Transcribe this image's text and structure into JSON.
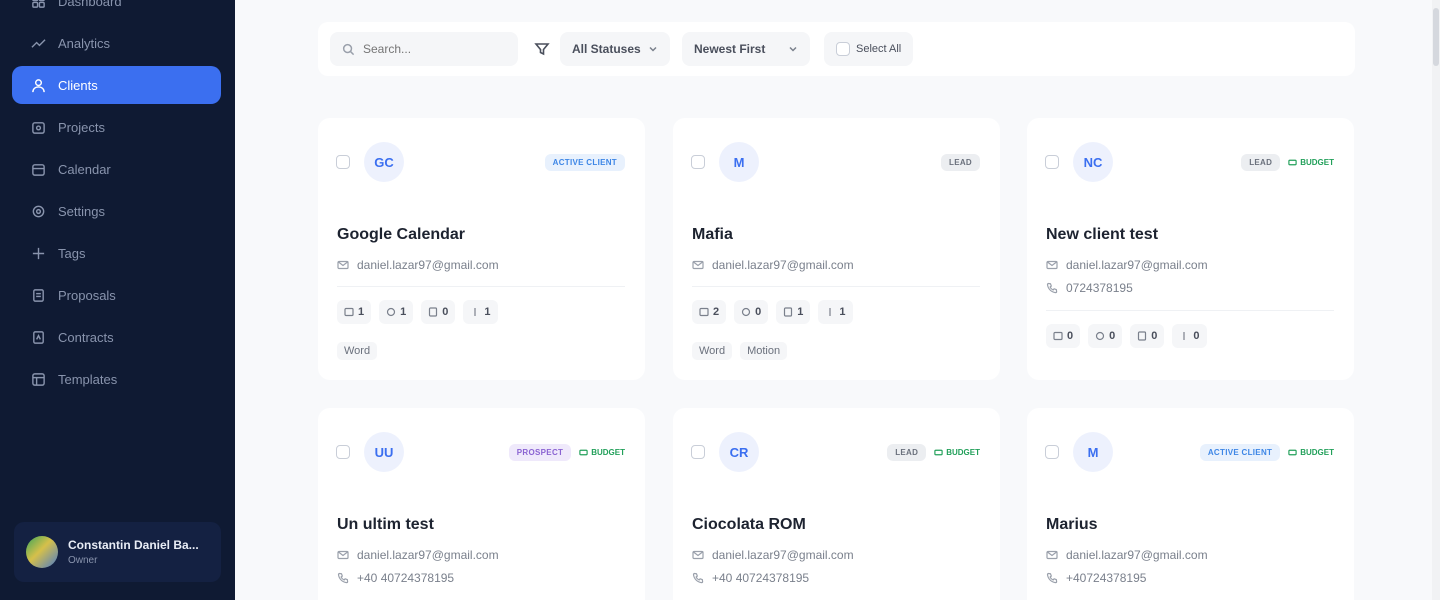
{
  "sidebar": {
    "items": [
      {
        "label": "Dashboard",
        "icon": "grid-icon",
        "active": false
      },
      {
        "label": "Analytics",
        "icon": "trend-icon",
        "active": false
      },
      {
        "label": "Clients",
        "icon": "user-icon",
        "active": true
      },
      {
        "label": "Projects",
        "icon": "folder-icon",
        "active": false
      },
      {
        "label": "Calendar",
        "icon": "calendar-icon",
        "active": false
      },
      {
        "label": "Settings",
        "icon": "gear-icon",
        "active": false
      },
      {
        "label": "Tags",
        "icon": "tag-icon",
        "active": false
      },
      {
        "label": "Proposals",
        "icon": "document-icon",
        "active": false
      },
      {
        "label": "Contracts",
        "icon": "contract-icon",
        "active": false
      },
      {
        "label": "Templates",
        "icon": "template-icon",
        "active": false
      }
    ],
    "user": {
      "name": "Constantin Daniel Ba...",
      "role": "Owner"
    }
  },
  "toolbar": {
    "search_placeholder": "Search...",
    "status_select": "All Statuses",
    "sort_select": "Newest First",
    "select_all_label": "Select All"
  },
  "clients": [
    {
      "initials": "GC",
      "name": "Google Calendar",
      "email": "daniel.lazar97@gmail.com",
      "phone": "",
      "badges": [
        {
          "text": "ACTIVE CLIENT",
          "kind": "active"
        }
      ],
      "budget": "",
      "stats": [
        "1",
        "1",
        "0",
        "1"
      ],
      "tags": [
        "Word"
      ]
    },
    {
      "initials": "M",
      "name": "Mafia",
      "email": "daniel.lazar97@gmail.com",
      "phone": "",
      "badges": [
        {
          "text": "LEAD",
          "kind": "lead"
        }
      ],
      "budget": "",
      "stats": [
        "2",
        "0",
        "1",
        "1"
      ],
      "tags": [
        "Word",
        "Motion"
      ]
    },
    {
      "initials": "NC",
      "name": "New client test",
      "email": "daniel.lazar97@gmail.com",
      "phone": "0724378195",
      "badges": [
        {
          "text": "LEAD",
          "kind": "lead"
        }
      ],
      "budget": "BUDGET",
      "stats": [
        "0",
        "0",
        "0",
        "0"
      ],
      "tags": []
    },
    {
      "initials": "UU",
      "name": "Un ultim test",
      "email": "daniel.lazar97@gmail.com",
      "phone": "+40 40724378195",
      "badges": [
        {
          "text": "PROSPECT",
          "kind": "prospect"
        }
      ],
      "budget": "BUDGET",
      "stats": [],
      "tags": []
    },
    {
      "initials": "CR",
      "name": "Ciocolata ROM",
      "email": "daniel.lazar97@gmail.com",
      "phone": "+40 40724378195",
      "badges": [
        {
          "text": "LEAD",
          "kind": "lead"
        }
      ],
      "budget": "BUDGET",
      "stats": [],
      "tags": []
    },
    {
      "initials": "M",
      "name": "Marius",
      "email": "daniel.lazar97@gmail.com",
      "phone": "+40724378195",
      "badges": [
        {
          "text": "ACTIVE CLIENT",
          "kind": "active"
        }
      ],
      "budget": "BUDGET",
      "stats": [],
      "tags": []
    }
  ],
  "colors": {
    "sidebar_bg": "#0f1a33",
    "accent": "#3b6ff0",
    "budget_green": "#22a05a"
  }
}
